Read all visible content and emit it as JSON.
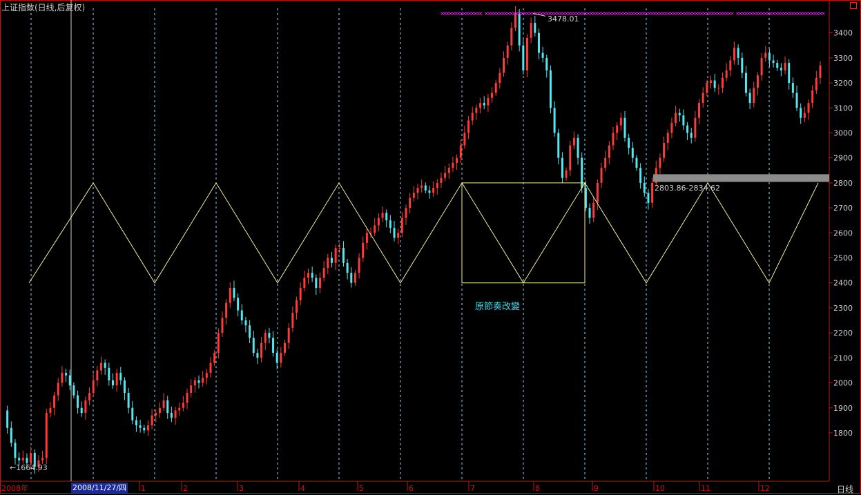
{
  "title": "上证指数(日线,后复权)",
  "period_label": "日线",
  "date_cursor": "2008/11/27/四",
  "note": "原節奏改變",
  "high_label": "3478.01",
  "low_label": "←1664.93",
  "range_label": "2803.86-2834.62",
  "colors": {
    "up": "#ff3a3a",
    "down": "#56e6f0",
    "axis": "#c81414",
    "grid": "#8fd9ff",
    "pattern": "#f2efa0",
    "band": "#8c8c8c",
    "marker": "#ff33ff"
  },
  "chart_data": {
    "type": "candlestick",
    "y_ticks": [
      1800,
      1900,
      2000,
      2100,
      2200,
      2300,
      2400,
      2500,
      2600,
      2700,
      2800,
      2900,
      3000,
      3100,
      3200,
      3300,
      3400
    ],
    "ylim": [
      1640,
      3500
    ],
    "x_labels": [
      "2008年",
      "1",
      "2",
      "3",
      "4",
      "5",
      "6",
      "7",
      "8",
      "9",
      "10",
      "11",
      "12"
    ],
    "close_series": [
      1890,
      1820,
      1760,
      1700,
      1690,
      1700,
      1680,
      1720,
      1665,
      1690,
      1700,
      1880,
      1900,
      1950,
      2000,
      2040,
      2030,
      1990,
      1950,
      1900,
      1880,
      1930,
      1960,
      2010,
      2050,
      2080,
      2060,
      2010,
      1990,
      2040,
      2010,
      1960,
      1900,
      1850,
      1830,
      1820,
      1810,
      1830,
      1870,
      1880,
      1900,
      1930,
      1880,
      1860,
      1890,
      1900,
      1920,
      1960,
      1990,
      2010,
      2000,
      2020,
      2040,
      2080,
      2120,
      2200,
      2260,
      2320,
      2380,
      2340,
      2290,
      2250,
      2230,
      2180,
      2120,
      2100,
      2160,
      2200,
      2180,
      2120,
      2080,
      2120,
      2160,
      2220,
      2280,
      2330,
      2380,
      2420,
      2440,
      2420,
      2380,
      2420,
      2460,
      2500,
      2480,
      2540,
      2540,
      2480,
      2440,
      2400,
      2440,
      2500,
      2560,
      2600,
      2600,
      2630,
      2660,
      2680,
      2650,
      2620,
      2580,
      2600,
      2660,
      2700,
      2740,
      2760,
      2780,
      2790,
      2770,
      2760,
      2780,
      2800,
      2820,
      2840,
      2860,
      2880,
      2900,
      2950,
      3000,
      3050,
      3080,
      3100,
      3120,
      3110,
      3140,
      3160,
      3200,
      3240,
      3300,
      3350,
      3420,
      3478,
      3350,
      3250,
      3380,
      3440,
      3400,
      3320,
      3300,
      3250,
      3100,
      3000,
      2900,
      2820,
      2850,
      2950,
      2980,
      2900,
      2780,
      2700,
      2660,
      2720,
      2800,
      2860,
      2900,
      2950,
      3000,
      3030,
      3060,
      2980,
      2940,
      2900,
      2860,
      2800,
      2760,
      2720,
      2800,
      2860,
      2900,
      2960,
      3000,
      3040,
      3080,
      3070,
      3030,
      3000,
      2980,
      3060,
      3120,
      3160,
      3200,
      3210,
      3180,
      3180,
      3220,
      3250,
      3290,
      3340,
      3300,
      3240,
      3160,
      3120,
      3180,
      3230,
      3300,
      3320,
      3290,
      3280,
      3260,
      3250,
      3280,
      3200,
      3160,
      3100,
      3060,
      3080,
      3120,
      3170,
      3220,
      3270
    ]
  }
}
